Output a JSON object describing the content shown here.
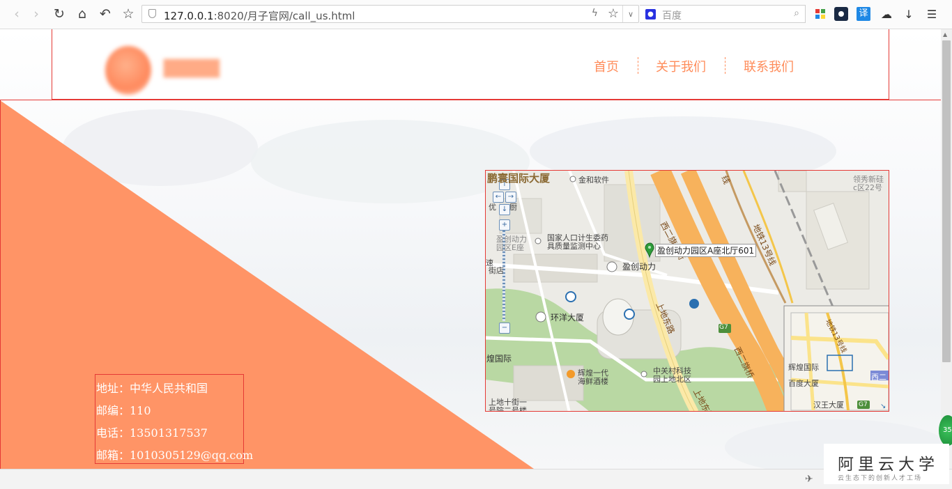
{
  "browser": {
    "url_host": "127.0.0.1",
    "url_rest": ":8020/月子官网/call_us.html",
    "search_placeholder": "百度",
    "translate_label": "译"
  },
  "header": {
    "nav": [
      {
        "label": "首页"
      },
      {
        "label": "关于我们"
      },
      {
        "label": "联系我们"
      }
    ]
  },
  "contact": {
    "address": "地址：中华人民共和国",
    "postcode": "邮编：110",
    "phone": "电话：13501317537",
    "email": "邮箱：1010305129@qq.com"
  },
  "map": {
    "pin_label": "盈创动力园区A座北厅601",
    "places": [
      "鹏寰国际大厦",
      "金和软件",
      "优",
      "厨",
      "国家人口计生委药",
      "具质量监测中心",
      "盈创动力",
      "环洋大厦",
      "煌国际",
      "辉煌一代",
      "海鲜酒楼",
      "中关村科技",
      "园上地北区",
      "上地十街一",
      "号院二号楼",
      "领秀新硅",
      "c区22号",
      "速",
      "街店",
      "盈创动力",
      "园区E座"
    ],
    "roads": [
      "西二旗大街",
      "上地东路",
      "地铁13号线",
      "西二旗桥",
      "上地东路",
      "线"
    ],
    "shield": "G7",
    "overview_labels": [
      "辉煌国际",
      "百度大厦",
      "汉王大厦",
      "西二",
      "地铁13号线"
    ],
    "overview_shield": "G7"
  },
  "watermark": {
    "title": "阿里云大学",
    "subtitle": "云生态下的创新人才工场",
    "badge": "35"
  },
  "colors": {
    "accent": "#ff8c5a",
    "triangle": "#ff9466",
    "border": "#e53935",
    "road_main": "#f7b25c",
    "road_minor": "#fbe9a8",
    "green": "#b9d8a3"
  }
}
